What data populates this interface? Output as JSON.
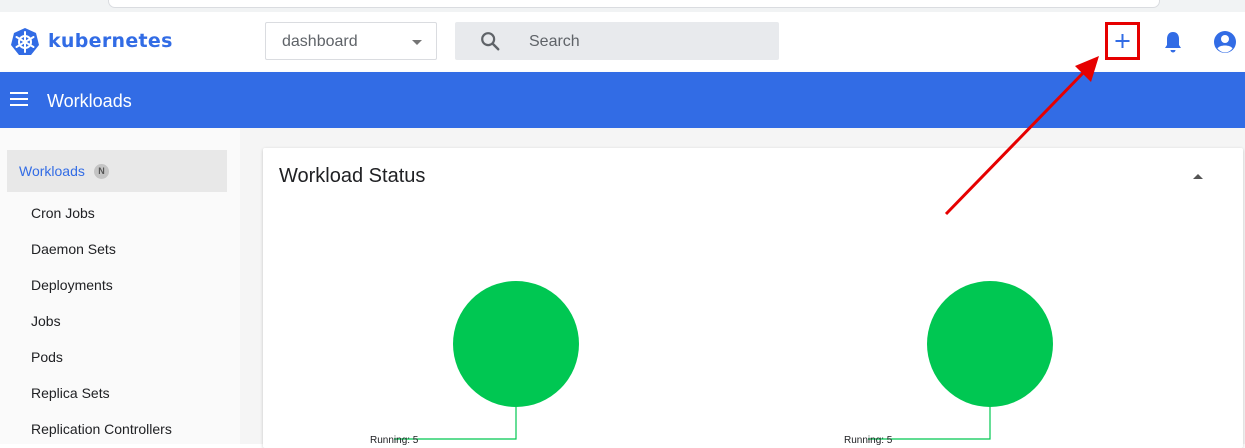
{
  "header": {
    "brand": "kubernetes",
    "namespace": "dashboard",
    "search_placeholder": "Search",
    "accent": "#326ce5"
  },
  "toolbar": {
    "icons": [
      "plus-icon",
      "bell-icon",
      "account-circle-icon"
    ]
  },
  "nav": {
    "title": "Workloads"
  },
  "sidebar": {
    "active": {
      "label": "Workloads",
      "badge": "N"
    },
    "items": [
      {
        "label": "Cron Jobs"
      },
      {
        "label": "Daemon Sets"
      },
      {
        "label": "Deployments"
      },
      {
        "label": "Jobs"
      },
      {
        "label": "Pods"
      },
      {
        "label": "Replica Sets"
      },
      {
        "label": "Replication Controllers"
      }
    ]
  },
  "card": {
    "title": "Workload Status"
  },
  "chart_data": [
    {
      "type": "pie",
      "slices": [
        {
          "label": "Running: 5",
          "value": 5,
          "color": "#00c752"
        }
      ]
    },
    {
      "type": "pie",
      "slices": [
        {
          "label": "Running: 5",
          "value": 5,
          "color": "#00c752"
        }
      ]
    }
  ],
  "annotation": {
    "color": "#e60000"
  }
}
